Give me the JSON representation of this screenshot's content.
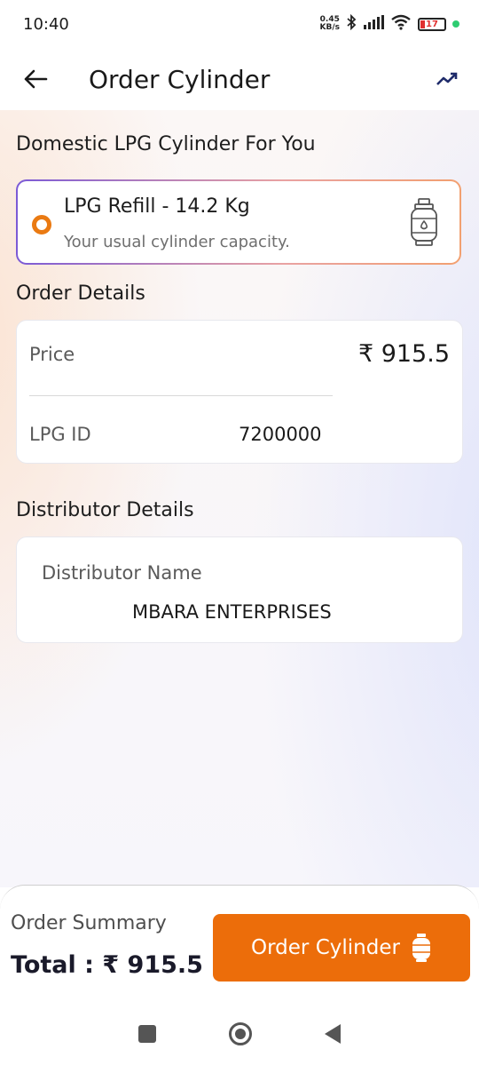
{
  "status": {
    "time": "10:40",
    "net_speed_top": "0.45",
    "net_speed_bottom": "KB/s",
    "battery": "17"
  },
  "header": {
    "title": "Order Cylinder"
  },
  "sections": {
    "domestic_title": "Domestic LPG Cylinder For You",
    "order_details_title": "Order Details",
    "distributor_title": "Distributor Details"
  },
  "refill": {
    "title": "LPG Refill - 14.2 Kg",
    "subtitle": "Your usual cylinder capacity.",
    "selected": true
  },
  "order_details": {
    "price_label": "Price",
    "price_value": "₹ 915.5",
    "lpg_id_label": "LPG ID",
    "lpg_id_value": "7200000"
  },
  "distributor": {
    "name_label": "Distributor Name",
    "name_value": "MBARA ENTERPRISES"
  },
  "summary": {
    "label": "Order Summary",
    "total": "Total : ₹ 915.5",
    "button_label": "Order Cylinder"
  },
  "colors": {
    "accent": "#ec6d0a",
    "card_border_start": "#7b5ad6",
    "card_border_end": "#f2a070"
  }
}
